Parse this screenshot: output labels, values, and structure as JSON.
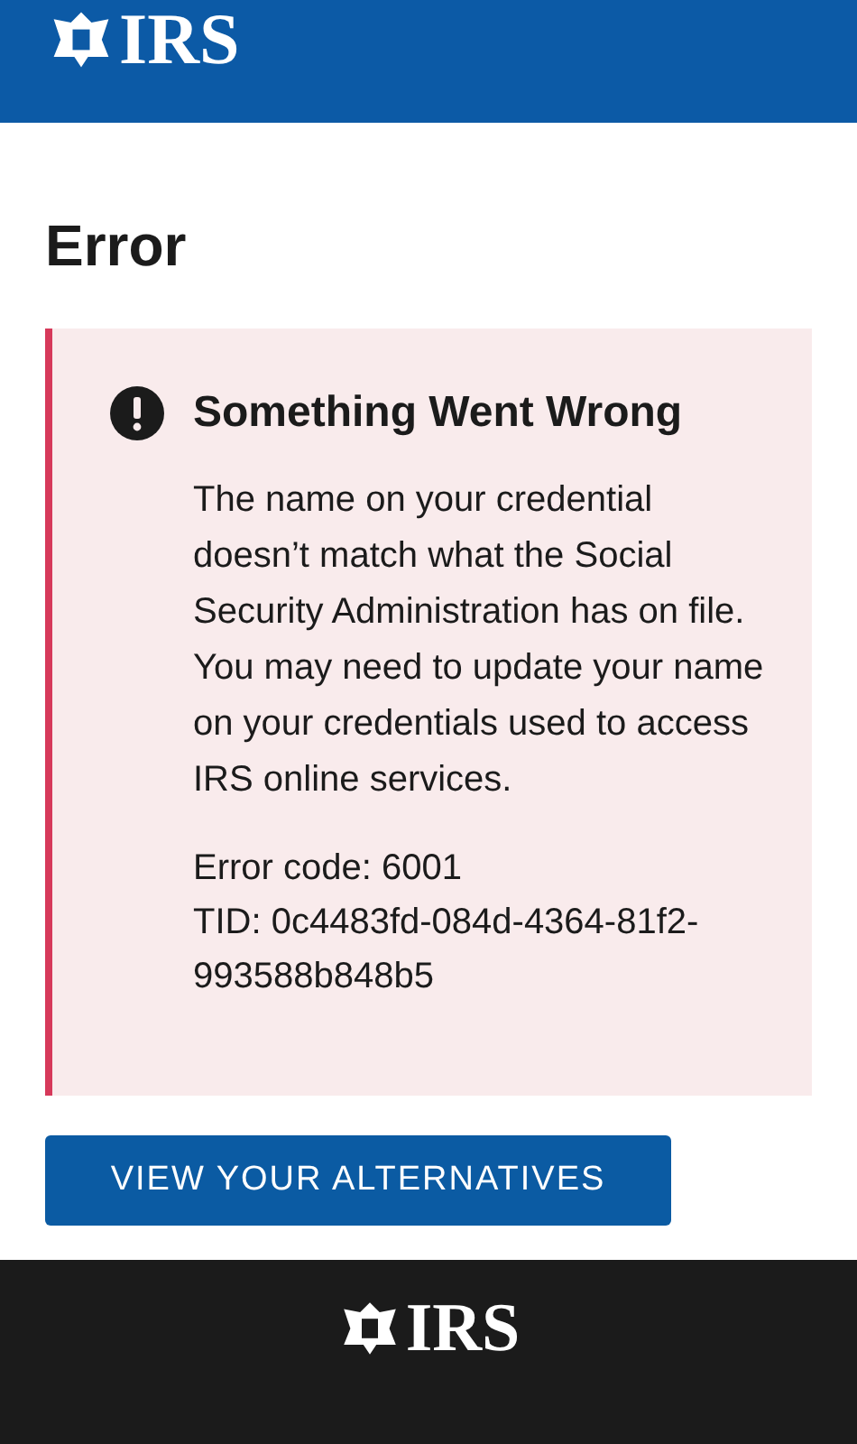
{
  "header": {
    "logo_text": "IRS"
  },
  "heading": "Error",
  "alert": {
    "title": "Something Went Wrong",
    "message": "The name on your credential doesn’t match what the Social Security Administration has on file. You may need to update your name on your credentials used to access IRS online services.",
    "details": [
      "Error code: 6001",
      "TID: 0c4483fd-084d-4364-81f2-993588b848b5"
    ]
  },
  "button": "VIEW YOUR ALTERNATIVES",
  "footer": {
    "logo_text": "IRS"
  }
}
